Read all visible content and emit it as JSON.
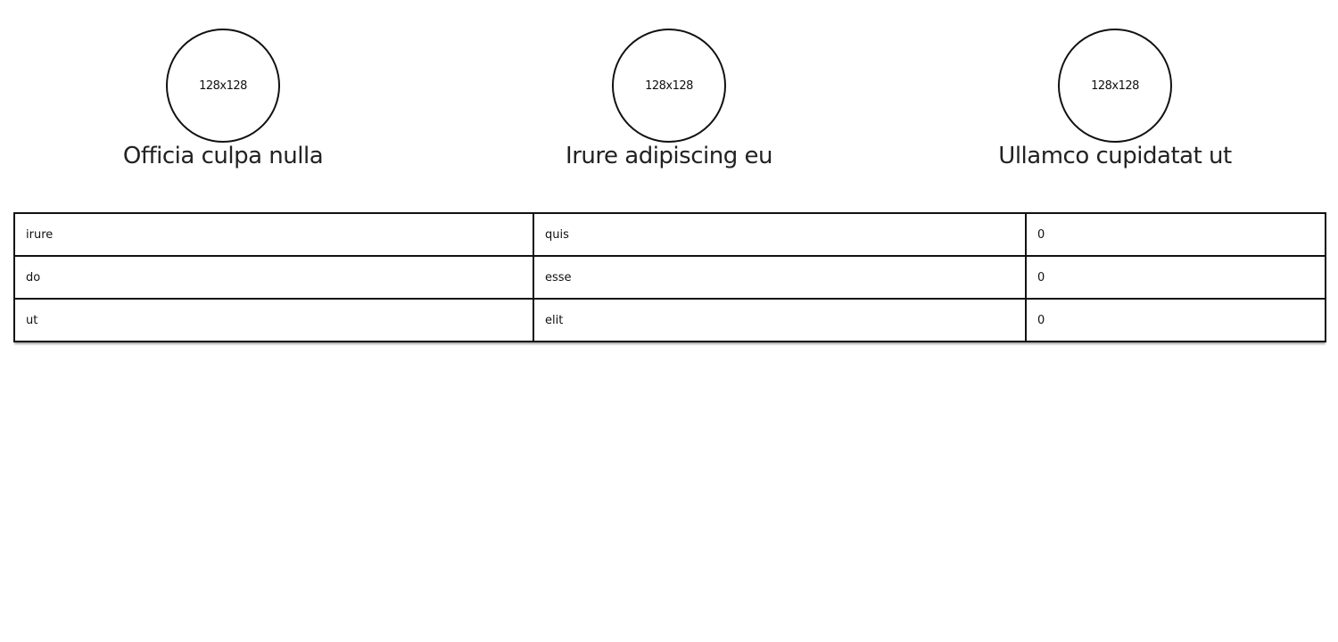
{
  "cards": [
    {
      "avatar_label": "128x128",
      "title": "Officia culpa nulla"
    },
    {
      "avatar_label": "128x128",
      "title": "Irure adipiscing eu"
    },
    {
      "avatar_label": "128x128",
      "title": "Ullamco cupidatat ut"
    }
  ],
  "table": {
    "rows": [
      [
        "irure",
        "quis",
        "0"
      ],
      [
        "do",
        "esse",
        "0"
      ],
      [
        "ut",
        "elit",
        "0"
      ]
    ]
  }
}
